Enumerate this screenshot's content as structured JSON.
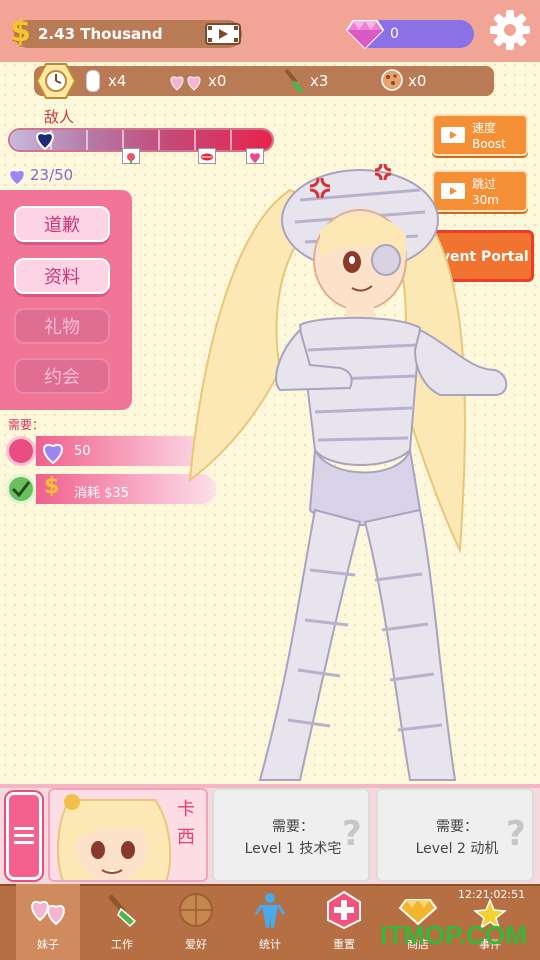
{
  "top_bar": {
    "money_symbol": "$",
    "money_value": "2.43 Thousand",
    "gem_count": "0"
  },
  "resources": {
    "diamond": "x4",
    "gift": "x0",
    "shovel": "x3",
    "cookie": "x0"
  },
  "enemy": {
    "label": "敌人",
    "affection_progress": 0.14
  },
  "love": {
    "count": "23/50"
  },
  "actions": [
    {
      "label": "道歉",
      "enabled": true
    },
    {
      "label": "资料",
      "enabled": true
    },
    {
      "label": "礼物",
      "enabled": false
    },
    {
      "label": "约会",
      "enabled": false
    }
  ],
  "requirements": {
    "label": "需要：",
    "items": [
      {
        "text": "50",
        "met": false
      },
      {
        "text": "消耗 $35",
        "met": true
      }
    ]
  },
  "side_buttons": {
    "speed": {
      "line1": "速度",
      "line2": "Boost"
    },
    "skip": {
      "line1": "跳过",
      "line2": "30m"
    },
    "event": "Event Portal"
  },
  "girls": {
    "active_name": "卡西",
    "locked": [
      {
        "need": "需要：",
        "req": "Level 1 技术宅",
        "q": "?"
      },
      {
        "need": "需要：",
        "req": "Level 2 动机",
        "q": "?"
      }
    ]
  },
  "nav": {
    "items": [
      {
        "label": "妹子",
        "icon": "hearts-icon",
        "active": true
      },
      {
        "label": "工作",
        "icon": "shovel-icon",
        "active": false
      },
      {
        "label": "爱好",
        "icon": "ball-icon",
        "active": false
      },
      {
        "label": "统计",
        "icon": "person-icon",
        "active": false
      },
      {
        "label": "重置",
        "icon": "reset-icon",
        "active": false
      },
      {
        "label": "商店",
        "icon": "shop-icon",
        "active": false
      },
      {
        "label": "事件",
        "icon": "event-icon",
        "active": false
      }
    ],
    "time": "12:21:02:51"
  },
  "watermark": "ITMOP.COM",
  "colors": {
    "accent_pink": "#f07596",
    "gem_purple": "#8a72e6",
    "wood_brown": "#b97a56",
    "orange": "#f58f36"
  }
}
